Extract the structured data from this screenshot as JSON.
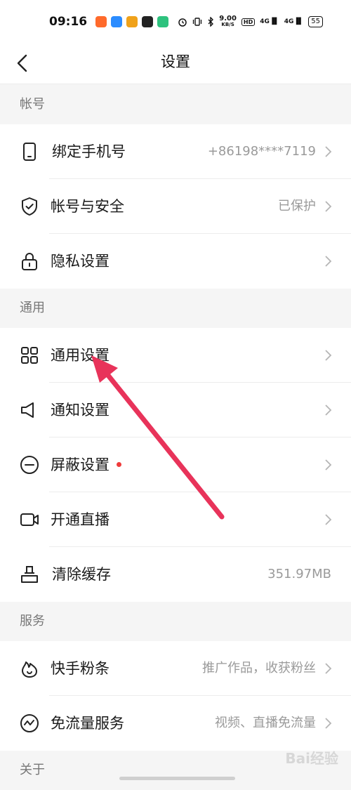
{
  "status_bar": {
    "time": "09:16",
    "speed_value": "9.00",
    "speed_unit": "KB/S",
    "hd": "HD",
    "net1": "4G",
    "net2": "4G",
    "battery": "55",
    "app_colors": [
      "#ff6a2b",
      "#2b8cff",
      "#f0a21a",
      "#222222",
      "#2ec27e"
    ]
  },
  "nav": {
    "title": "设置",
    "back_icon": "chevron-left-icon"
  },
  "sections": {
    "account": "帐号",
    "general": "通用",
    "services": "服务",
    "about": "关于"
  },
  "rows": {
    "bind_phone": {
      "label": "绑定手机号",
      "value": "+86198****7119",
      "icon": "phone-icon"
    },
    "account_security": {
      "label": "帐号与安全",
      "value": "已保护",
      "icon": "shield-icon"
    },
    "privacy": {
      "label": "隐私设置",
      "icon": "lock-icon"
    },
    "general_settings": {
      "label": "通用设置",
      "icon": "grid-icon"
    },
    "notifications": {
      "label": "通知设置",
      "icon": "speaker-icon"
    },
    "block_settings": {
      "label": "屏蔽设置",
      "icon": "minus-circle-icon",
      "badge": "red-dot"
    },
    "live": {
      "label": "开通直播",
      "icon": "video-camera-icon"
    },
    "clear_cache": {
      "label": "清除缓存",
      "value": "351.97MB",
      "icon": "broom-icon"
    },
    "fans_boost": {
      "label": "快手粉条",
      "value": "推广作品，收获粉丝",
      "icon": "flame-icon"
    },
    "free_data": {
      "label": "免流量服务",
      "value": "视频、直播免流量",
      "icon": "wave-circle-icon"
    }
  },
  "watermark": "Bai经验",
  "colors": {
    "accent_arrow": "#e8335a",
    "badge": "#ef3b3b",
    "secondary_text": "#9a9a9a"
  }
}
